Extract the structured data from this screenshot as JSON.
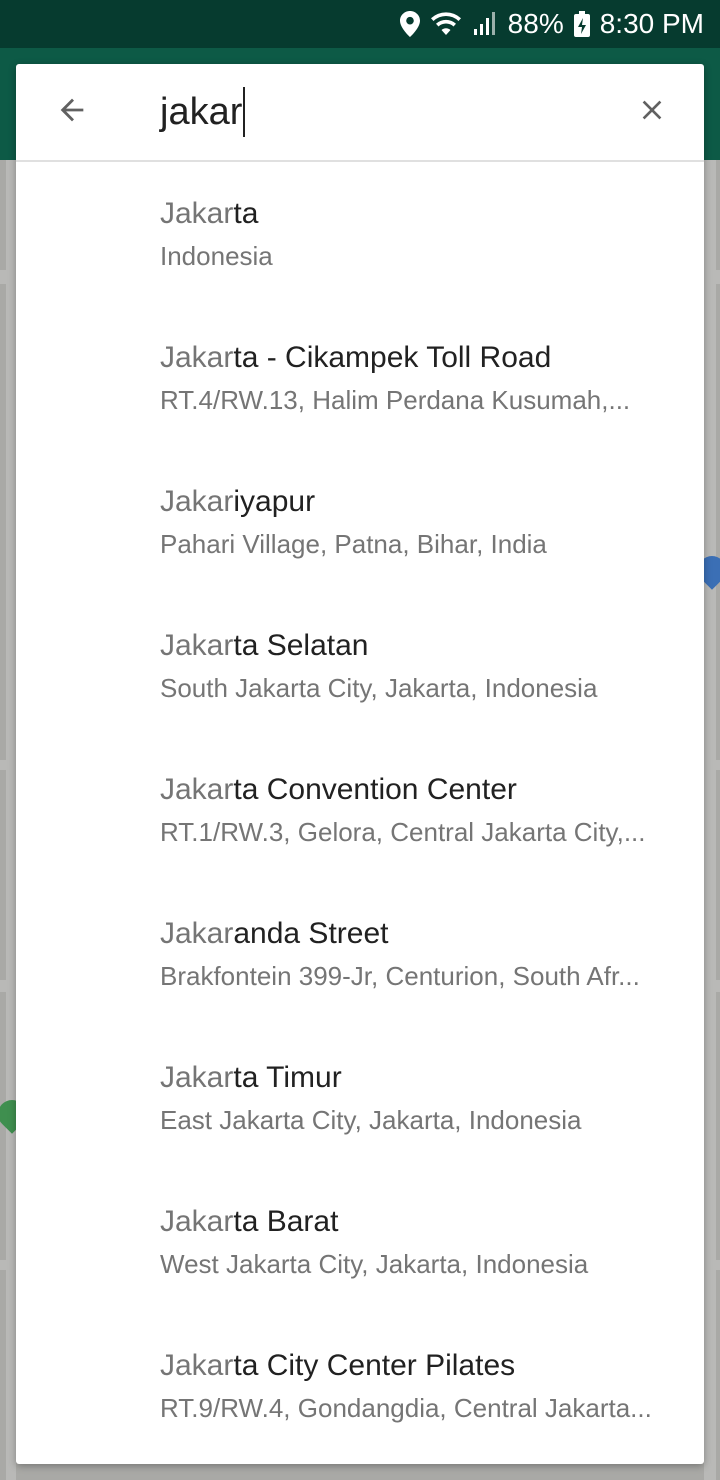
{
  "status_bar": {
    "battery": "88%",
    "time": "8:30 PM",
    "icons": [
      "location-icon",
      "wifi-icon",
      "signal-icon",
      "battery-icon"
    ]
  },
  "search": {
    "query": "jakar",
    "back_icon": "arrow-back-icon",
    "clear_icon": "close-icon"
  },
  "results": [
    {
      "match": "Jakar",
      "rest": "ta",
      "subtitle": "Indonesia"
    },
    {
      "match": "Jakar",
      "rest": "ta - Cikampek Toll Road",
      "subtitle": "RT.4/RW.13, Halim Perdana Kusumah,..."
    },
    {
      "match": "Jakar",
      "rest": "iyapur",
      "subtitle": "Pahari Village, Patna, Bihar, India"
    },
    {
      "match": "Jakar",
      "rest": "ta Selatan",
      "subtitle": "South Jakarta City, Jakarta, Indonesia"
    },
    {
      "match": "Jakar",
      "rest": "ta Convention Center",
      "subtitle": "RT.1/RW.3, Gelora, Central Jakarta City,..."
    },
    {
      "match": "Jakar",
      "rest": "anda Street",
      "subtitle": "Brakfontein 399-Jr, Centurion, South Afr..."
    },
    {
      "match": "Jakar",
      "rest": "ta Timur",
      "subtitle": "East Jakarta City, Jakarta, Indonesia"
    },
    {
      "match": "Jakar",
      "rest": "ta Barat",
      "subtitle": "West Jakarta City, Jakarta, Indonesia"
    },
    {
      "match": "Jakar",
      "rest": "ta City Center Pilates",
      "subtitle": "RT.9/RW.4, Gondangdia, Central Jakarta..."
    }
  ],
  "colors": {
    "status_bar": "#063b2f",
    "app_header": "#0d5a46",
    "match_text": "#757575",
    "title_text": "#212121"
  }
}
